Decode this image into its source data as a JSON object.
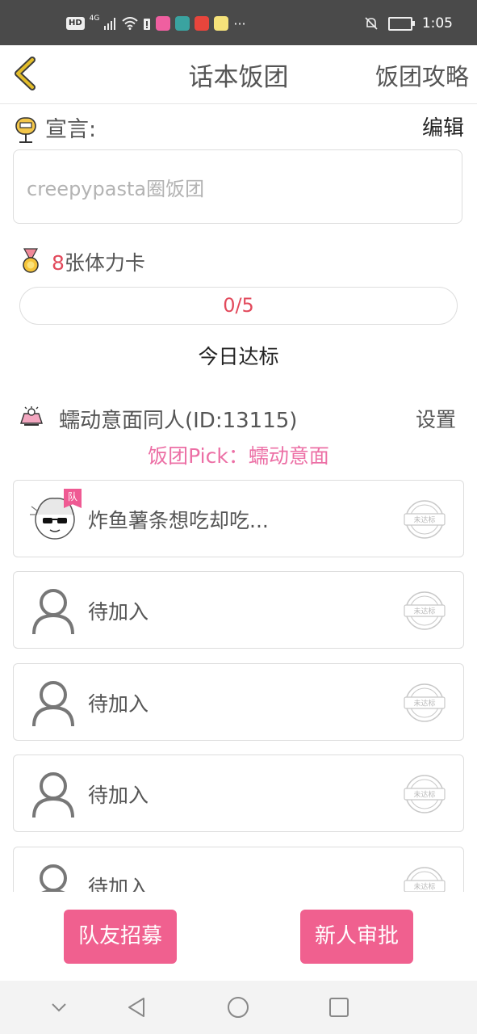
{
  "status_bar": {
    "hd": "HD",
    "network": "4G",
    "time": "1:05"
  },
  "header": {
    "title": "话本饭团",
    "right_link": "饭团攻略"
  },
  "declaration": {
    "label": "宣言:",
    "edit": "编辑",
    "text": "creepypasta圈饭团"
  },
  "stamina": {
    "count": "8",
    "label": "张体力卡",
    "progress": "0/5",
    "progress_value": 0,
    "target_label": "今日达标"
  },
  "group": {
    "name": "蠕动意面同人(ID:13115)",
    "settings": "设置",
    "pick": "饭团Pick：蠕动意面"
  },
  "members": [
    {
      "name": "炸鱼薯条想吃却吃...",
      "badge": "队",
      "stamp": "未达标"
    },
    {
      "name": "待加入",
      "stamp": "未达标"
    },
    {
      "name": "待加入",
      "stamp": "未达标"
    },
    {
      "name": "待加入",
      "stamp": "未达标"
    },
    {
      "name": "待加入",
      "stamp": "未达标"
    }
  ],
  "buttons": {
    "recruit": "队友招募",
    "approve": "新人审批"
  },
  "colors": {
    "accent_pink": "#f0608f",
    "pick_pink": "#ec6fa5",
    "number_red": "#e24a5c",
    "back_arrow": "#c9a227"
  }
}
